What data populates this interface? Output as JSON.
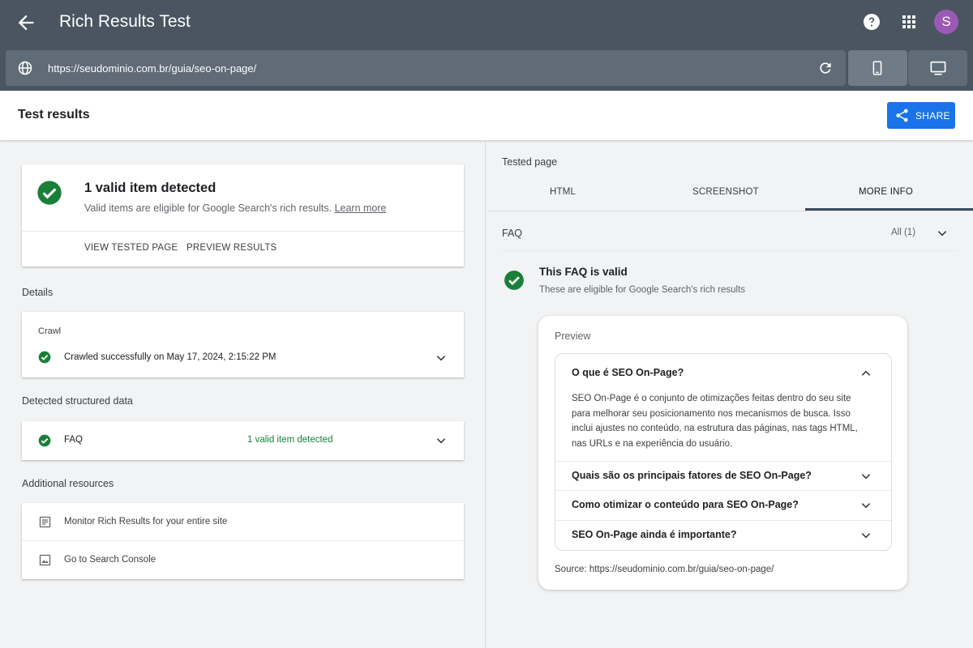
{
  "header": {
    "title": "Rich Results Test",
    "avatar_letter": "S",
    "url": "https://seudominio.com.br/guia/seo-on-page/"
  },
  "results": {
    "title": "Test results",
    "share_label": "SHARE"
  },
  "summary": {
    "title": "1 valid item detected",
    "description": "Valid items are eligible for Google Search's rich results.",
    "learn_more": "Learn more",
    "view_tested_page": "VIEW TESTED PAGE",
    "preview_results": "PREVIEW RESULTS"
  },
  "details": {
    "label": "Details",
    "crawl_title": "Crawl",
    "crawl_status": "Crawled successfully on May 17, 2024, 2:15:22 PM"
  },
  "structured": {
    "label": "Detected structured data",
    "item": "FAQ",
    "status": "1 valid item detected"
  },
  "resources": {
    "label": "Additional resources",
    "items": [
      "Monitor Rich Results for your entire site",
      "Go to Search Console"
    ]
  },
  "tested_page": {
    "label": "Tested page",
    "tabs": [
      "HTML",
      "SCREENSHOT",
      "MORE INFO"
    ],
    "active_tab": "MORE INFO"
  },
  "faq_panel": {
    "label": "FAQ",
    "filter": "All (1)",
    "valid_title": "This FAQ is valid",
    "valid_desc": "These are eligible for Google Search's rich results"
  },
  "preview": {
    "label": "Preview",
    "questions": [
      "O que é SEO On-Page?",
      "Quais são os principais fatores de SEO On-Page?",
      "Como otimizar o conteúdo para SEO On-Page?",
      "SEO On-Page ainda é importante?"
    ],
    "answer": "SEO On-Page é o conjunto de otimizações feitas dentro do seu site para melhorar seu posicionamento nos mecanismos de busca. Isso inclui ajustes no conteúdo, na estrutura das páginas, nas tags HTML, nas URLs e na experiência do usuário.",
    "source": "Source: https://seudominio.com.br/guia/seo-on-page/"
  },
  "colors": {
    "header_bg": "#4a5561",
    "accent_blue": "#1a73e8",
    "success_green": "#188038"
  },
  "icons": [
    "back-arrow-icon",
    "help-icon",
    "apps-grid-icon",
    "globe-icon",
    "reload-icon",
    "smartphone-icon",
    "desktop-icon",
    "share-icon",
    "check-circle-icon",
    "chevron-down-icon",
    "chevron-up-icon",
    "article-icon",
    "image-icon"
  ]
}
